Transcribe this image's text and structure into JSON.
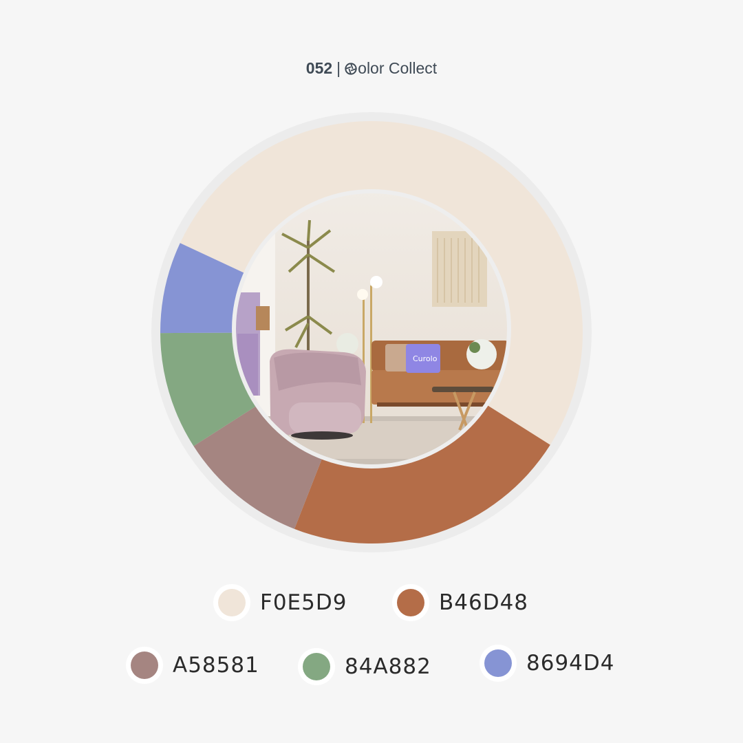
{
  "header": {
    "number": "052",
    "separator": "|",
    "brand": "olor Collect",
    "brand_icon": "aperture-icon"
  },
  "photo": {
    "description_icon": "interior-photo",
    "pillow_text": "Curolo"
  },
  "colors": {
    "ring_bg": "#ececec",
    "inner_border": "#eeeeee"
  },
  "chart_data": {
    "type": "pie",
    "slices": [
      {
        "hex": "F0E5D9",
        "color": "#F0E5D9",
        "value": 52
      },
      {
        "hex": "B46D48",
        "color": "#B46D48",
        "value": 22
      },
      {
        "hex": "A58581",
        "color": "#A58581",
        "value": 10
      },
      {
        "hex": "84A882",
        "color": "#84A882",
        "value": 9
      },
      {
        "hex": "8694D4",
        "color": "#8694D4",
        "value": 7
      }
    ],
    "start_angle_deg": -65,
    "direction": "clockwise"
  },
  "legend": [
    {
      "label": "F0E5D9",
      "color": "#F0E5D9"
    },
    {
      "label": "B46D48",
      "color": "#B46D48"
    },
    {
      "label": "A58581",
      "color": "#A58581"
    },
    {
      "label": "84A882",
      "color": "#84A882"
    },
    {
      "label": "8694D4",
      "color": "#8694D4"
    }
  ]
}
